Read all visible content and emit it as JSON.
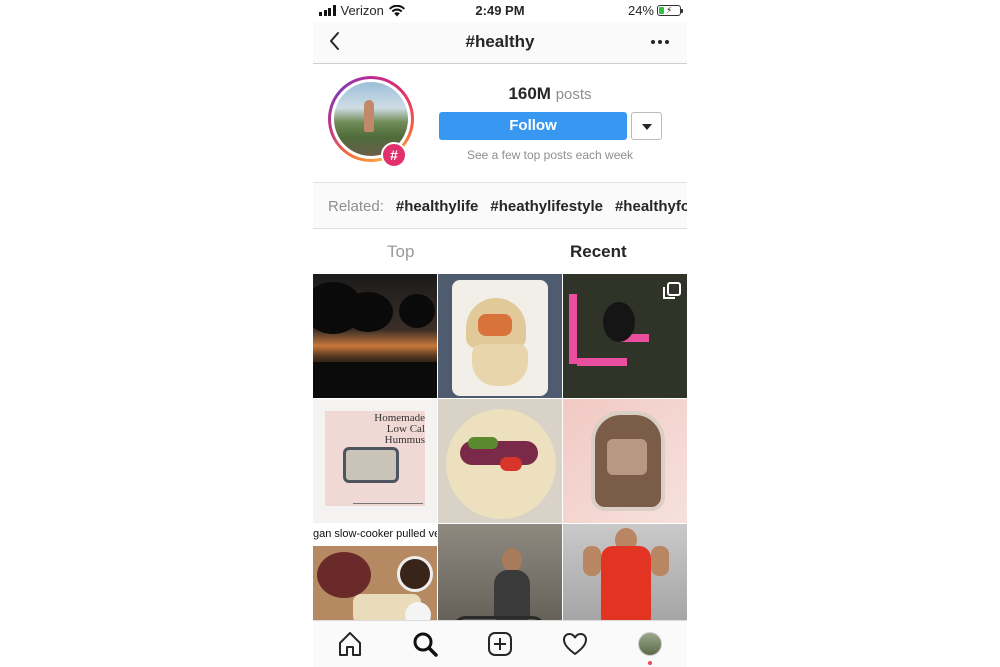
{
  "status_bar": {
    "carrier": "Verizon",
    "time": "2:49 PM",
    "battery": "24%",
    "battery_level": 0.24,
    "icons": [
      "signal-icon",
      "wifi-icon",
      "battery-icon"
    ]
  },
  "nav": {
    "title": "#healthy",
    "back_icon": "chevron-left-icon",
    "more_icon": "more-horizontal-icon"
  },
  "header": {
    "post_count": "160M",
    "post_label": "posts",
    "follow_label": "Follow",
    "hint": "See a few top posts each week",
    "badge_glyph": "#"
  },
  "related": {
    "label": "Related:",
    "tags": [
      "#healthylife",
      "#heathylifestyle",
      "#healthyfoo"
    ]
  },
  "tabs": {
    "top": "Top",
    "recent": "Recent",
    "active": "recent"
  },
  "grid": {
    "tile4_text": "Homemade Low Cal Hummus",
    "tile7_caption": "gan slow-cooker pulled veg"
  },
  "tab_bar": {
    "icons": [
      "home-icon",
      "search-icon",
      "add-post-icon",
      "heart-icon",
      "profile-avatar"
    ]
  },
  "colors": {
    "accent": "#3897f0",
    "text": "#262626",
    "muted": "#8e8e8e",
    "notification": "#ed4956"
  }
}
